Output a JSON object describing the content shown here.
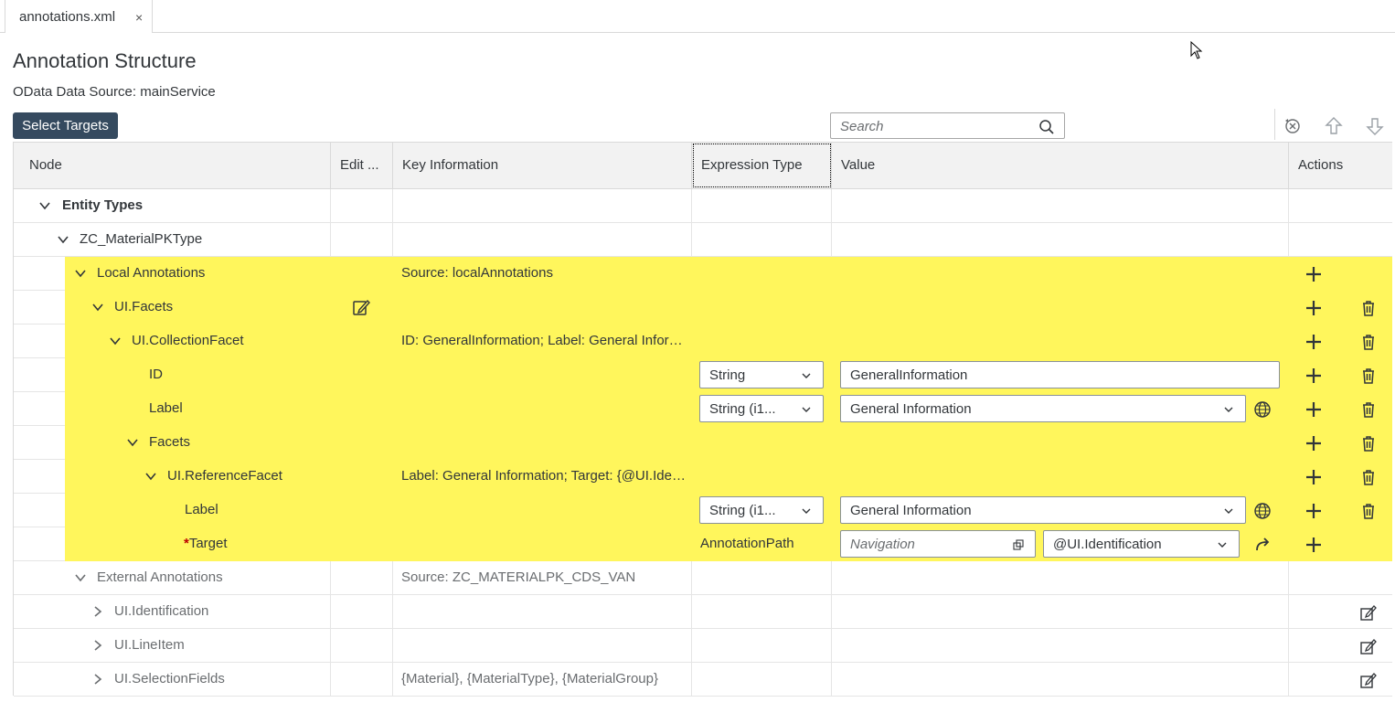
{
  "tabs": [
    {
      "label": "annotations.xml",
      "close": "×"
    }
  ],
  "page": {
    "title": "Annotation Structure",
    "subtitle": "OData Data Source: mainService"
  },
  "toolbar": {
    "select_targets": "Select Targets",
    "search_placeholder": "Search",
    "icons": [
      "clear-filter-icon",
      "move-up-icon",
      "move-down-icon"
    ]
  },
  "columns": [
    "Node",
    "Edit ...",
    "Key Information",
    "Expression Type",
    "Value",
    "Actions"
  ],
  "rows": [
    {
      "node": "Entity Types",
      "key": ""
    },
    {
      "node": "ZC_MaterialPKType",
      "key": ""
    },
    {
      "node": "Local Annotations",
      "key": "Source: localAnnotations"
    },
    {
      "node": "UI.Facets",
      "key": ""
    },
    {
      "node": "UI.CollectionFacet",
      "key": "ID: GeneralInformation; Label: General Information"
    },
    {
      "node": "ID",
      "expr": "String",
      "value": "GeneralInformation"
    },
    {
      "node": "Label",
      "expr": "String (i1...",
      "value": "General Information"
    },
    {
      "node": "Facets",
      "key": ""
    },
    {
      "node": "UI.ReferenceFacet",
      "key": "Label: General Information; Target: {@UI.Identification}"
    },
    {
      "node": "Label",
      "expr": "String (i1...",
      "value": "General Information"
    },
    {
      "node": "Target",
      "required": "*",
      "expr": "AnnotationPath",
      "nav_placeholder": "Navigation",
      "value": "@UI.Identification"
    },
    {
      "node": "External Annotations",
      "key": "Source: ZC_MATERIALPK_CDS_VAN"
    },
    {
      "node": "UI.Identification",
      "key": ""
    },
    {
      "node": "UI.LineItem",
      "key": ""
    },
    {
      "node": "UI.SelectionFields",
      "key": "{Material}, {MaterialType}, {MaterialGroup}"
    }
  ],
  "colors": {
    "highlight": "#fff65c",
    "button_bg": "#354a5f",
    "header_bg": "#f2f2f2"
  }
}
